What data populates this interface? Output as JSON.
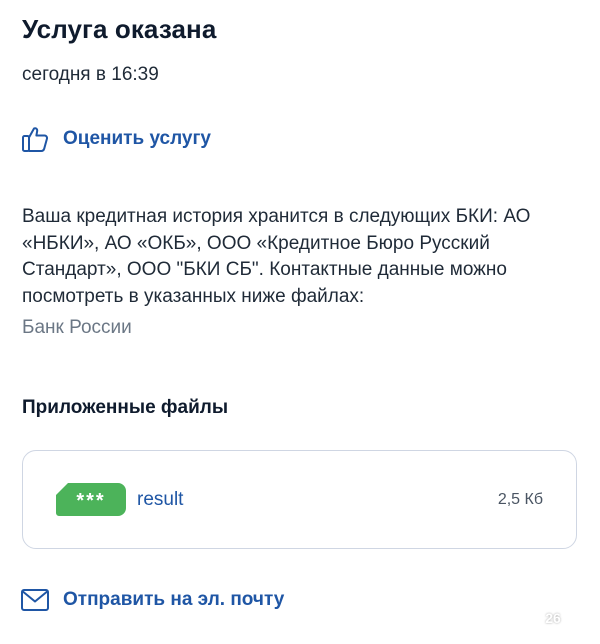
{
  "header": {
    "title": "Услуга оказана",
    "timestamp": "сегодня в 16:39"
  },
  "rate": {
    "label": "Оценить услугу",
    "icon": "thumbs-up-icon"
  },
  "message": {
    "text": "Ваша кредитная история хранится в следующих БКИ: АО «НБКИ», АО «ОКБ», ООО «Кредитное Бюро Русский Стандарт», ООО \"БКИ СБ\". Контактные данные можно посмотреть в указанных ниже файлах:",
    "source": "Банк России"
  },
  "attachments": {
    "section_title": "Приложенные файлы",
    "files": [
      {
        "badge": "***",
        "name": "result",
        "size": "2,5 Кб"
      }
    ]
  },
  "email": {
    "label": "Отправить на эл. почту",
    "icon": "envelope-icon"
  },
  "overlay": {
    "like_count": "26",
    "icon": "heart-icon"
  },
  "colors": {
    "link": "#1f56a5",
    "file_badge": "#4cb35a",
    "border": "#cfd6e3",
    "muted": "#6b7785"
  }
}
